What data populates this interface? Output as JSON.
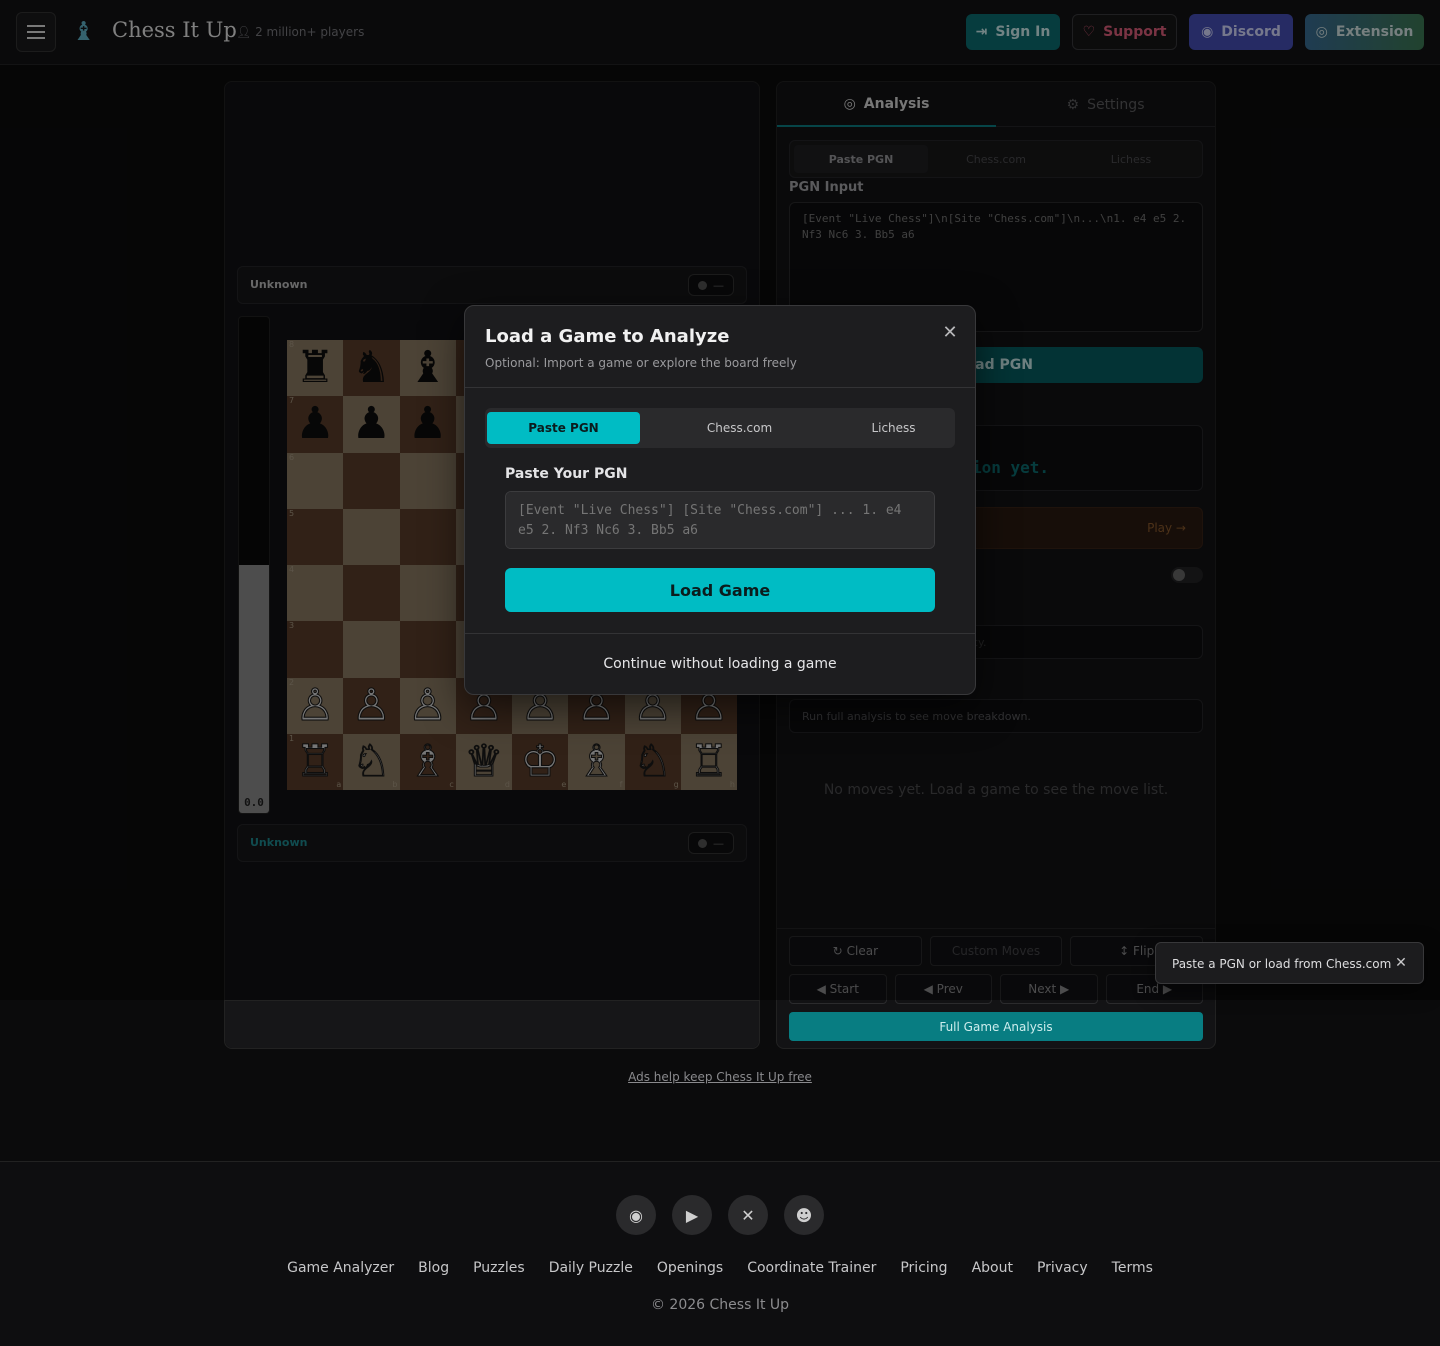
{
  "header": {
    "brand": "Chess It Up",
    "players": "2 million+ players",
    "buttons": {
      "signin": "Sign In",
      "support": "Support",
      "discord": "Discord",
      "extension": "Extension"
    },
    "colors": {
      "signin": "#0b6e71",
      "support_text": "#e1607c",
      "discord": "#454fb6"
    }
  },
  "board": {
    "top_player": "Unknown",
    "bottom_player": "Unknown",
    "pill": "—",
    "eval": "0.0",
    "eval_white_fraction": 0.5,
    "ranks": [
      "8",
      "7",
      "6",
      "5",
      "4",
      "3",
      "2",
      "1"
    ],
    "files": [
      "a",
      "b",
      "c",
      "d",
      "e",
      "f",
      "g",
      "h"
    ],
    "position": [
      [
        "♜",
        "♞",
        "♝",
        "♛",
        "♚",
        "♝",
        "♞",
        "♜"
      ],
      [
        "♟",
        "♟",
        "♟",
        "♟",
        "♟",
        "♟",
        "♟",
        "♟"
      ],
      [
        "",
        "",
        "",
        "",
        "",
        "",
        "",
        ""
      ],
      [
        "",
        "",
        "",
        "",
        "",
        "",
        "",
        ""
      ],
      [
        "",
        "",
        "",
        "",
        "",
        "",
        "",
        ""
      ],
      [
        "",
        "",
        "",
        "",
        "",
        "",
        "",
        ""
      ],
      [
        "♙",
        "♙",
        "♙",
        "♙",
        "♙",
        "♙",
        "♙",
        "♙"
      ],
      [
        "♖",
        "♘",
        "♗",
        "♕",
        "♔",
        "♗",
        "♘",
        "♖"
      ]
    ]
  },
  "right": {
    "tabs": {
      "analysis": "Analysis",
      "settings": "Settings"
    },
    "subtabs": [
      "Paste PGN",
      "Chess.com",
      "Lichess"
    ],
    "pgn_label": "PGN Input",
    "pgn_placeholder": "[Event \"Live Chess\"]\\n[Site \"Chess.com\"]\\n...\\n1. e4 e5 2. Nf3 Nc6 3. Bb5 a6",
    "load_pgn": "Load PGN",
    "eval_partial": "ion yet.",
    "play_link": "Play →",
    "acc_partial": "cy.",
    "breakdown_hint": "Run full analysis to see move breakdown.",
    "no_moves": "No moves yet. Load a game to see the move list.",
    "controls_row1": [
      "Clear",
      "Custom Moves",
      "↕ Flip"
    ],
    "controls_row2": [
      "◀ Start",
      "◀ Prev",
      "Next ▶",
      "End ▶"
    ],
    "full_analysis": "Full Game Analysis"
  },
  "ads": "Ads help keep Chess It Up free",
  "modal": {
    "title": "Load a Game to Analyze",
    "subtitle": "Optional: Import a game or explore the board freely",
    "tabs": [
      "Paste PGN",
      "Chess.com",
      "Lichess"
    ],
    "label": "Paste Your PGN",
    "placeholder": "[Event \"Live Chess\"] [Site \"Chess.com\"] ... 1. e4 e5 2. Nf3 Nc6 3. Bb5 a6",
    "load": "Load Game",
    "continue": "Continue without loading a game",
    "accent": "#00bcc4"
  },
  "toast": {
    "text": "Paste a PGN or load from Chess.com"
  },
  "footer": {
    "socials": [
      "discord-icon",
      "youtube-icon",
      "x-icon",
      "reddit-icon"
    ],
    "links": [
      "Game Analyzer",
      "Blog",
      "Puzzles",
      "Daily Puzzle",
      "Openings",
      "Coordinate Trainer",
      "Pricing",
      "About",
      "Privacy",
      "Terms"
    ],
    "copyright": "© 2026 Chess It Up"
  }
}
